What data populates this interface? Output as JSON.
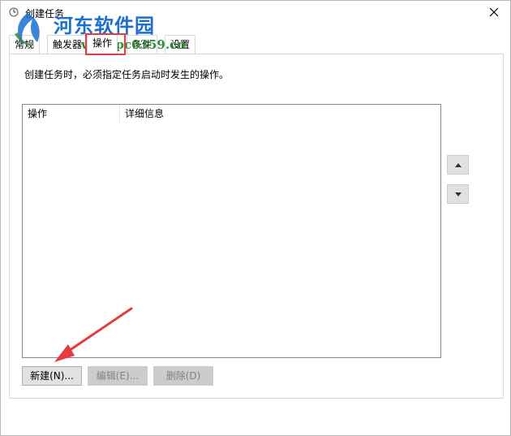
{
  "window": {
    "title": "创建任务"
  },
  "watermark": {
    "text": "河东软件园",
    "url": "www.pc0359.cn"
  },
  "tabs": [
    {
      "label": "常规"
    },
    {
      "label": "触发器"
    },
    {
      "label": "操作"
    },
    {
      "label": "条件"
    },
    {
      "label": "设置"
    }
  ],
  "panel": {
    "description": "创建任务时，必须指定任务启动时发生的操作。",
    "columns": [
      {
        "label": "操作"
      },
      {
        "label": "详细信息"
      }
    ]
  },
  "buttons": {
    "new": "新建(N)...",
    "edit": "编辑(E)...",
    "delete": "删除(D)"
  },
  "colors": {
    "highlight": "#e43c3c",
    "accent": "#1a6fd0"
  },
  "icons": {
    "title": "clock-icon",
    "close": "close-icon",
    "move_up": "triangle-up-icon",
    "move_down": "triangle-down-icon"
  }
}
